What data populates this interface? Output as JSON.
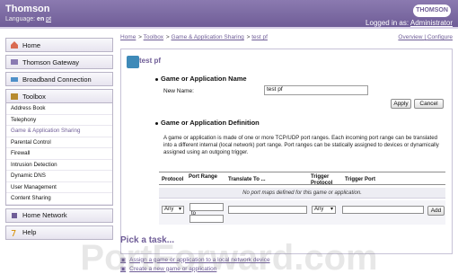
{
  "header": {
    "brand": "Thomson",
    "language_label": "Language:",
    "lang_en": "en",
    "lang_pt": "pt",
    "logo": "THOMSON",
    "logo_sub": "images & beyond",
    "logged_in_label": "Logged in as:",
    "user": "Administrator"
  },
  "sidebar": {
    "home": "Home",
    "thomson_gateway": "Thomson Gateway",
    "broadband": "Broadband Connection",
    "toolbox": "Toolbox",
    "toolbox_items": [
      "Address Book",
      "Telephony",
      "Game & Application Sharing",
      "Parental Control",
      "Firewall",
      "Intrusion Detection",
      "Dynamic DNS",
      "User Management",
      "Content Sharing"
    ],
    "home_network": "Home Network",
    "help": "Help"
  },
  "breadcrumbs": [
    "Home",
    "Toolbox",
    "Game & Application Sharing",
    "test pf"
  ],
  "breadcrumb_sep": ">",
  "top_links": {
    "overview": "Overview",
    "configure": "Configure"
  },
  "panel": {
    "title": "test pf",
    "section1_title": "Game or Application Name",
    "new_name_label": "New Name:",
    "new_name_value": "test pf",
    "apply": "Apply",
    "cancel": "Cancel",
    "section2_title": "Game or Application Definition",
    "description": "A game or application is made of one or more TCP/UDP port ranges. Each incoming port range can be translated into a different internal (local network) port range. Port ranges can be statically assigned to devices or dynamically assigned using an outgoing trigger.",
    "table_headers": {
      "protocol": "Protocol",
      "port_range": "Port Range",
      "translate_to": "Translate To ...",
      "trigger_protocol": "Trigger Protocol",
      "trigger_port": "Trigger Port"
    },
    "empty_message": "No port maps defined for this game or application.",
    "protocol_select": "Any",
    "trigger_select": "Any",
    "to_label": "to",
    "add": "Add"
  },
  "tasks": {
    "title": "Pick a task...",
    "task1": "Assign a game or application to a local network device",
    "task2": "Create a new game or application"
  },
  "watermark": "PortForward.com"
}
